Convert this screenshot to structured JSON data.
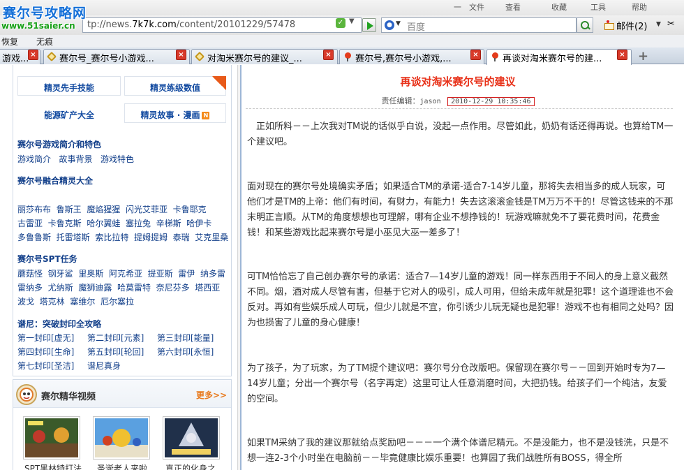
{
  "browser": {
    "menu_items": [
      "一",
      "文件",
      "查看",
      "收藏",
      "工具",
      "帮助"
    ],
    "address": {
      "prefix": "tp://news.",
      "domain": "7k7k.com",
      "suffix": "/content/20101229/57478"
    },
    "search": {
      "engine": "百度",
      "placeholder": "百度"
    },
    "mail_label": "邮件(2)",
    "link_bar": [
      "恢复",
      "无痕"
    ],
    "tabs": [
      {
        "label": "游戏..."
      },
      {
        "label": "赛尔号_赛尔号小游戏..."
      },
      {
        "label": "对淘米赛尔号的建议_..."
      },
      {
        "label": "赛尔号,赛尔号小游戏,..."
      },
      {
        "label": "再谈对淘米赛尔号的建..."
      }
    ]
  },
  "watermark": {
    "logo": "赛尔号攻略网",
    "url": "www.51saier.cn"
  },
  "sidebar": {
    "top_links": [
      "精灵先手技能",
      "精灵练级数值",
      "能源矿产大全",
      "精灵故事 · 漫画"
    ],
    "rss_label": "N",
    "sections": [
      {
        "title": "赛尔号游戏简介和特色",
        "rows": [
          [
            "游戏简介",
            "故事背景",
            "游戏特色"
          ]
        ]
      },
      {
        "title": "赛尔号融合精灵大全",
        "rows": [
          [
            "丽莎布布",
            "鲁斯王",
            "魔焰猩猩",
            "闪光艾菲亚",
            "卡鲁耶克"
          ],
          [
            "古雷亚",
            "卡鲁克斯",
            "哈尔翼蛙",
            "塞拉兔",
            "辛梯斯",
            "哈伊卡"
          ],
          [
            "多鲁鲁斯",
            "托雷塔斯",
            "索比拉特",
            "提姆提姆",
            "泰瑞",
            "艾克里桑"
          ]
        ]
      },
      {
        "title": "赛尔号SPT任务",
        "rows": [
          [
            "蘑菇怪",
            "钢牙鲨",
            "里奥斯",
            "阿克希亚",
            "提亚斯",
            "雷伊",
            "纳多雷"
          ],
          [
            "雷纳多",
            "尤纳斯",
            "魔狮迪露",
            "哈莫雷特",
            "奈尼芬多",
            "塔西亚"
          ],
          [
            "波戈",
            "塔克林",
            "塞维尔",
            "厄尔塞拉"
          ]
        ]
      },
      {
        "title": "谱尼：突破封印全攻略",
        "rows": [
          [
            "第一封印[虚无]",
            "第二封印[元素]",
            "第三封印[能量]"
          ],
          [
            "第四封印[生命]",
            "第五封印[轮回]",
            "第六封印[永恒]"
          ],
          [
            "第七封印[圣洁]",
            "谱尼真身"
          ]
        ]
      }
    ],
    "video": {
      "title": "赛尔精华视频",
      "more": "更多>>",
      "items": [
        {
          "caption": "SPT黑林特打法"
        },
        {
          "caption": "圣诞老人来啦"
        },
        {
          "caption": "真正的化身之"
        }
      ]
    }
  },
  "article": {
    "title": "再谈对淘米赛尔号的建议",
    "editor_label": "责任编辑：",
    "editor": "jason",
    "date": "2010-12-29 10:35:46",
    "paragraphs": [
      "正如所料－－上次我对TM说的话似乎白说，没起一点作用。尽管如此，奶奶有话还得再说。也算给TM一个建议吧。",
      "面对现在的赛尔号处境确实矛盾；如果适合TM的承诺-适合7-14岁儿童，那将失去相当多的成人玩家，可他们才是TM的上帝：他们有时间，有财力，有能力！失去这滚滚金钱是TM万万不干的！尽管这钱来的不那末明正言顺。从TM的角度想想也可理解，哪有企业不想挣钱的！玩游戏嘛就免不了要花费时间，花费金钱！和某些游戏比起来赛尔号是小巫见大巫一差多了！",
      "可TM恰恰忘了自己创办赛尔号的承诺：适合7—14岁儿童的游戏！同一样东西用于不同人的身上意义截然不同。烟，酒对成人尽管有害，但基于它对人的吸引，成人可用，但给未成年就是犯罪！这个道理谁也不会反对。再如有些娱乐成人可玩，但少儿就是不宜，你引诱少儿玩无疑也是犯罪！游戏不也有相同之处吗？因为也损害了儿童的身心健康！",
      "为了孩子，为了玩家，为了TM提个建议吧：赛尔号分仓改版吧。保留现在赛尔号－－回到开始时专为7—14岁儿童；分出一个赛尔号（名字再定）这里可让人任意消磨时间，大把扔钱。给孩子们一个纯洁，友爱的空间。",
      "如果TM采纳了我的建议那就给点奖励吧－－－一个满个体谱尼精元。不是没能力，也不是没钱洗，只是不想一连2-3个小时坐在电脑前－－毕竟健康比娱乐重要！也算园了我们战胜所有BOSS，得全所"
    ]
  }
}
